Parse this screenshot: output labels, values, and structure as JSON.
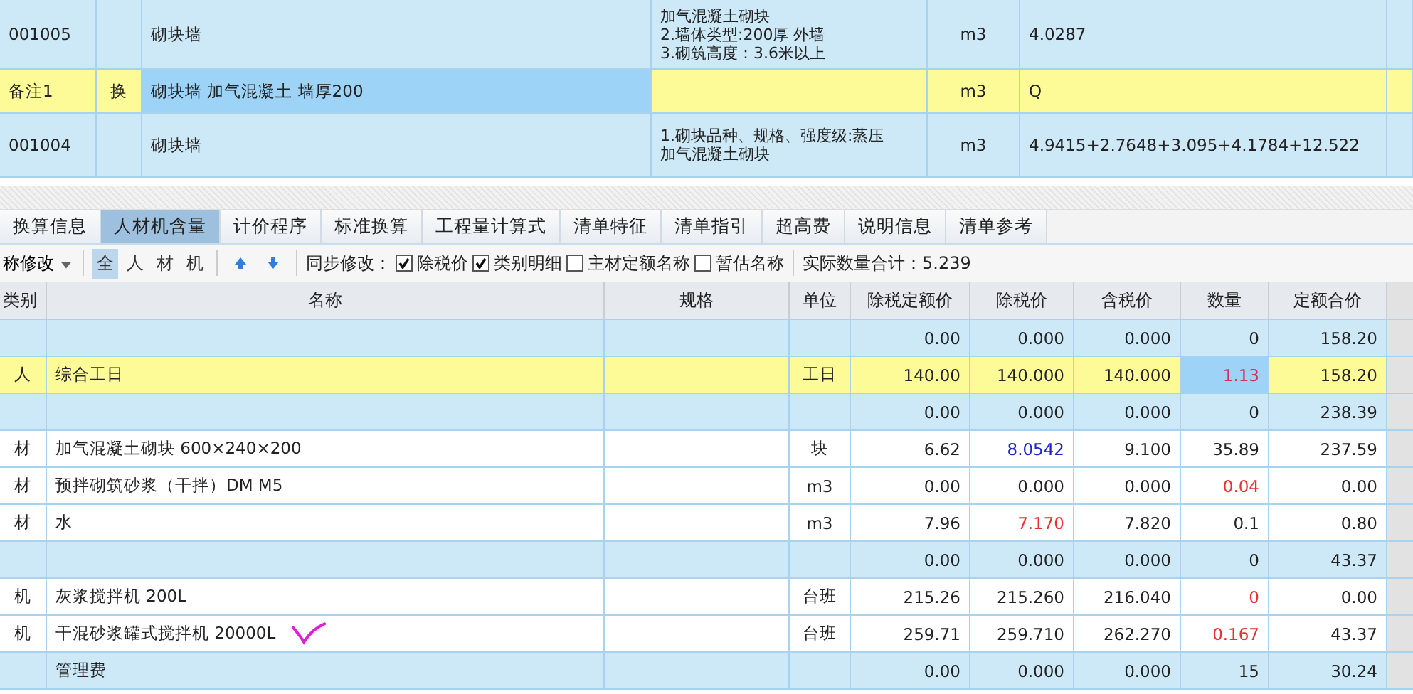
{
  "top_table": {
    "rows": [
      {
        "code": "001005",
        "type": "",
        "name": "砌块墙",
        "features": [
          "加气混凝土砌块",
          "2.墙体类型:200厚 外墙",
          "3.砌筑高度：3.6米以上"
        ],
        "unit": "m3",
        "quantity": "4.0287",
        "selected": false
      },
      {
        "code": "备注1",
        "type": "换",
        "name": "砌块墙 加气混凝土 墙厚200",
        "features": [],
        "unit": "m3",
        "quantity": "Q",
        "selected": true
      },
      {
        "code": "001004",
        "type": "",
        "name": "砌块墙",
        "features": [
          "1.砌块品种、规格、强度级:蒸压",
          "加气混凝土砌块"
        ],
        "unit": "m3",
        "quantity": "4.9415+2.7648+3.095+4.1784+12.522",
        "selected": false
      }
    ]
  },
  "tabs": [
    {
      "label": "换算信息",
      "selected": false
    },
    {
      "label": "人材机含量",
      "selected": true
    },
    {
      "label": "计价程序",
      "selected": false
    },
    {
      "label": "标准换算",
      "selected": false
    },
    {
      "label": "工程量计算式",
      "selected": false
    },
    {
      "label": "清单特征",
      "selected": false
    },
    {
      "label": "清单指引",
      "selected": false
    },
    {
      "label": "超高费",
      "selected": false
    },
    {
      "label": "说明信息",
      "selected": false
    },
    {
      "label": "清单参考",
      "selected": false
    }
  ],
  "toolbar": {
    "dropdown": "称修改",
    "filters": [
      {
        "label": "全",
        "selected": true
      },
      {
        "label": "人",
        "selected": false
      },
      {
        "label": "材",
        "selected": false
      },
      {
        "label": "机",
        "selected": false
      }
    ],
    "sync_label": "同步修改：",
    "checkboxes": [
      {
        "label": "除税价",
        "checked": true
      },
      {
        "label": "类别明细",
        "checked": true
      },
      {
        "label": "主材定额名称",
        "checked": false
      },
      {
        "label": "暂估名称",
        "checked": false
      }
    ],
    "total": "实际数量合计：5.239"
  },
  "table": {
    "columns": [
      "类别",
      "名称",
      "规格",
      "单位",
      "除税定额价",
      "除税价",
      "含税价",
      "数量",
      "定额合价"
    ],
    "rows": [
      {
        "kind": "group",
        "category": "",
        "name": "",
        "unit": "",
        "base": "0.00",
        "price": "0.000",
        "tax_price": "0.000",
        "qty": "0",
        "total": "158.20"
      },
      {
        "kind": "selected",
        "category": "人",
        "name": "综合工日",
        "unit": "工日",
        "base": "140.00",
        "price": "140.000",
        "tax_price": "140.000",
        "qty": {
          "text": "1.13",
          "color": "#d0305a"
        },
        "total": "158.20"
      },
      {
        "kind": "group",
        "category": "",
        "name": "",
        "unit": "",
        "base": "0.00",
        "price": "0.000",
        "tax_price": "0.000",
        "qty": "0",
        "total": "238.39"
      },
      {
        "kind": "item",
        "category": "材",
        "name": "加气混凝土砌块 600×240×200",
        "unit": "块",
        "base": "6.62",
        "price": {
          "text": "8.0542",
          "color": "#2020d0"
        },
        "tax_price": "9.100",
        "qty": "35.89",
        "total": "237.59"
      },
      {
        "kind": "item",
        "category": "材",
        "name": "预拌砌筑砂浆（干拌）DM M5",
        "unit": "m3",
        "base": "0.00",
        "price": "0.000",
        "tax_price": "0.000",
        "qty": {
          "text": "0.04",
          "color": "#e83030"
        },
        "total": "0.00"
      },
      {
        "kind": "item",
        "category": "材",
        "name": "水",
        "unit": "m3",
        "base": "7.96",
        "price": {
          "text": "7.170",
          "color": "#e83030"
        },
        "tax_price": "7.820",
        "qty": "0.1",
        "total": "0.80"
      },
      {
        "kind": "group",
        "category": "",
        "name": "",
        "unit": "",
        "base": "0.00",
        "price": "0.000",
        "tax_price": "0.000",
        "qty": "0",
        "total": "43.37"
      },
      {
        "kind": "item",
        "category": "机",
        "name": "灰浆搅拌机 200L",
        "unit": "台班",
        "base": "215.26",
        "price": "215.260",
        "tax_price": "216.040",
        "qty": {
          "text": "0",
          "color": "#e83030"
        },
        "total": "0.00"
      },
      {
        "kind": "item",
        "category": "机",
        "name": "干混砂浆罐式搅拌机 20000L",
        "unit": "台班",
        "base": "259.71",
        "price": "259.710",
        "tax_price": "262.270",
        "qty": {
          "text": "0.167",
          "color": "#e83030"
        },
        "total": "43.37",
        "marked": true
      },
      {
        "kind": "group",
        "category": "",
        "name": "管理费",
        "unit": "",
        "base": "0.00",
        "price": "0.000",
        "tax_price": "0.000",
        "qty": "15",
        "total": "30.24"
      }
    ]
  }
}
